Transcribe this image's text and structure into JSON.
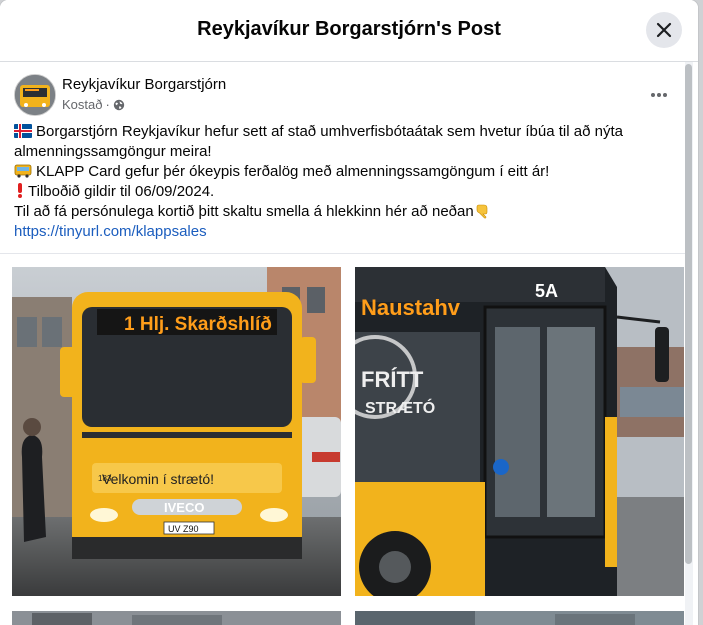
{
  "modal": {
    "title": "Reykjavíkur Borgarstjórn's Post"
  },
  "post": {
    "author": "Reykjavíkur Borgarstjórn",
    "sponsored_label": "Kostað",
    "separator": "·",
    "lines": [
      "Borgarstjórn Reykjavíkur hefur sett af stað umhverfisbótaátak sem hvetur íbúa til að nýta",
      "almenningssamgöngur meira!",
      "KLAPP Card gefur þér ókeypis ferðalög með almenningssamgöngum í eitt ár!",
      "Tilboðið gildir til 06/09/2024.",
      "Til að fá persónulega kortið þitt skaltu smella á hlekkinn hér að neðan"
    ],
    "link": "https://tinyurl.com/klappsales",
    "photo1": {
      "destination_sign": "1 Hlj. Skarðshlíð",
      "welcome_text": "Velkomin í strætó!",
      "brand": "IVECO",
      "plate": "UV Z90",
      "number": "183"
    },
    "photo2": {
      "destination_sign": "Naustahv",
      "side_logo_line1": "FRÍTT",
      "side_logo_line2": "STRÆTÓ",
      "roof_number": "5A"
    }
  },
  "icons": {
    "close": "close-icon",
    "more": "more-horizontal-icon",
    "globe": "globe-icon",
    "flag": "iceland-flag-icon",
    "bus": "bus-icon",
    "exclamation": "exclamation-icon",
    "pointing": "pointing-down-hand-icon"
  },
  "colors": {
    "link": "#1b5dbe",
    "bus_yellow": "#f2b31c",
    "led_orange": "#ff9d1a"
  }
}
